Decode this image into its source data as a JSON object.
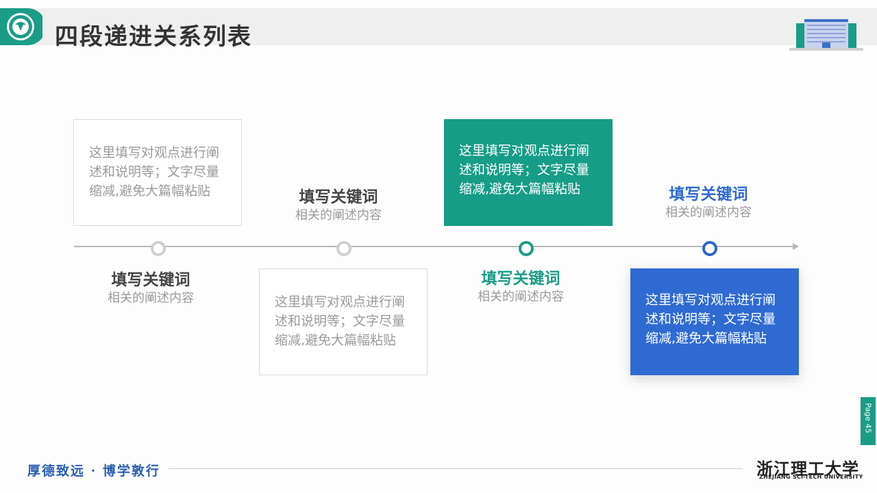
{
  "header": {
    "title": "四段递进关系列表"
  },
  "steps": [
    {
      "keyword": "填写关键词",
      "desc": "相关的阐述内容",
      "box_lines": [
        "这里填写对观点进行阐",
        "述和说明等；文字尽量",
        "缩减,避免大篇幅粘贴"
      ]
    },
    {
      "keyword": "填写关键词",
      "desc": "相关的阐述内容",
      "box_lines": [
        "这里填写对观点进行阐",
        "述和说明等；文字尽量",
        "缩减,避免大篇幅粘贴"
      ]
    },
    {
      "keyword": "填写关键词",
      "desc": "相关的阐述内容",
      "box_lines": [
        "这里填写对观点进行阐",
        "述和说明等；文字尽量",
        "缩减,避免大篇幅粘贴"
      ]
    },
    {
      "keyword": "填写关键词",
      "desc": "相关的阐述内容",
      "box_lines": [
        "这里填写对观点进行阐",
        "述和说明等；文字尽量",
        "缩减,避免大篇幅粘贴"
      ]
    }
  ],
  "colors": {
    "teal": "#1a9c87",
    "blue": "#2f6ad3",
    "gray": "#cfcfcf"
  },
  "footer": {
    "motto": "厚德致远 · 博学敦行",
    "university_cn": "浙江理工大学",
    "university_en": "ZHEJIANG SCI-TECH UNIVERSITY",
    "page_label": "Page 45"
  }
}
